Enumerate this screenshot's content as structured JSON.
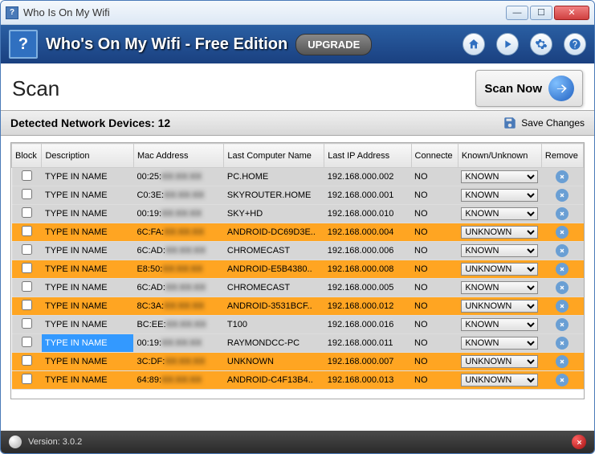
{
  "window": {
    "title": "Who Is On My Wifi"
  },
  "header": {
    "app_title": "Who's On My Wifi -  Free Edition",
    "upgrade": "UPGRADE"
  },
  "scan": {
    "heading": "Scan",
    "scan_now": "Scan Now"
  },
  "detected": {
    "label": "Detected Network Devices: 12",
    "save": "Save Changes"
  },
  "columns": {
    "block": "Block",
    "description": "Description",
    "mac": "Mac Address",
    "name": "Last Computer Name",
    "ip": "Last IP Address",
    "connected": "Connecte",
    "known": "Known/Unknown",
    "remove": "Remove"
  },
  "rows": [
    {
      "style": "gray",
      "desc": "TYPE IN NAME",
      "mac_prefix": "00:25:",
      "mac_rest": "XX:XX:XX",
      "name": "PC.HOME",
      "ip": "192.168.000.002",
      "conn": "NO",
      "known": "KNOWN"
    },
    {
      "style": "gray",
      "desc": "TYPE IN NAME",
      "mac_prefix": "C0:3E:",
      "mac_rest": "XX:XX:XX",
      "name": "SKYROUTER.HOME",
      "ip": "192.168.000.001",
      "conn": "NO",
      "known": "KNOWN"
    },
    {
      "style": "gray",
      "desc": "TYPE IN NAME",
      "mac_prefix": "00:19:",
      "mac_rest": "XX:XX:XX",
      "name": "SKY+HD",
      "ip": "192.168.000.010",
      "conn": "NO",
      "known": "KNOWN"
    },
    {
      "style": "orange",
      "desc": "TYPE IN NAME",
      "mac_prefix": "6C:FA:",
      "mac_rest": "XX:XX:XX",
      "name": "ANDROID-DC69D3E..",
      "ip": "192.168.000.004",
      "conn": "NO",
      "known": "UNKNOWN"
    },
    {
      "style": "gray",
      "desc": "TYPE IN NAME",
      "mac_prefix": "6C:AD:",
      "mac_rest": "XX:XX:XX",
      "name": "CHROMECAST",
      "ip": "192.168.000.006",
      "conn": "NO",
      "known": "KNOWN"
    },
    {
      "style": "orange",
      "desc": "TYPE IN NAME",
      "mac_prefix": "E8:50:",
      "mac_rest": "XX:XX:XX",
      "name": "ANDROID-E5B4380..",
      "ip": "192.168.000.008",
      "conn": "NO",
      "known": "UNKNOWN"
    },
    {
      "style": "gray",
      "desc": "TYPE IN NAME",
      "mac_prefix": "6C:AD:",
      "mac_rest": "XX:XX:XX",
      "name": "CHROMECAST",
      "ip": "192.168.000.005",
      "conn": "NO",
      "known": "KNOWN"
    },
    {
      "style": "orange",
      "desc": "TYPE IN NAME",
      "mac_prefix": "8C:3A:",
      "mac_rest": "XX:XX:XX",
      "name": "ANDROID-3531BCF..",
      "ip": "192.168.000.012",
      "conn": "NO",
      "known": "UNKNOWN"
    },
    {
      "style": "gray",
      "desc": "TYPE IN NAME",
      "mac_prefix": "BC:EE:",
      "mac_rest": "XX:XX:XX",
      "name": "T100",
      "ip": "192.168.000.016",
      "conn": "NO",
      "known": "KNOWN"
    },
    {
      "style": "gray selected",
      "desc": "TYPE IN NAME",
      "mac_prefix": "00:19:",
      "mac_rest": "XX:XX:XX",
      "name": "RAYMONDCC-PC",
      "ip": "192.168.000.011",
      "conn": "NO",
      "known": "KNOWN"
    },
    {
      "style": "orange",
      "desc": "TYPE IN NAME",
      "mac_prefix": "3C:DF:",
      "mac_rest": "XX:XX:XX",
      "name": "UNKNOWN",
      "ip": "192.168.000.007",
      "conn": "NO",
      "known": "UNKNOWN"
    },
    {
      "style": "orange",
      "desc": "TYPE IN NAME",
      "mac_prefix": "64:89:",
      "mac_rest": "XX:XX:XX",
      "name": "ANDROID-C4F13B4..",
      "ip": "192.168.000.013",
      "conn": "NO",
      "known": "UNKNOWN"
    }
  ],
  "known_options": [
    "KNOWN",
    "UNKNOWN"
  ],
  "footer": {
    "version": "Version: 3.0.2"
  }
}
